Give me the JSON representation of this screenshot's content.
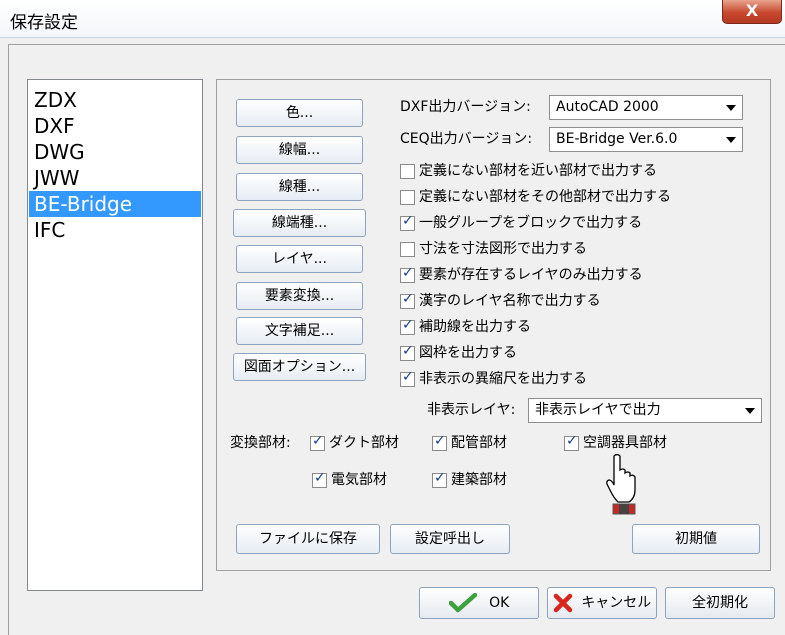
{
  "window": {
    "title": "保存設定",
    "close_label": "X"
  },
  "formats": [
    "ZDX",
    "DXF",
    "DWG",
    "JWW",
    "BE-Bridge",
    "IFC"
  ],
  "selected_format": "BE-Bridge",
  "side_buttons": [
    "色...",
    "線幅...",
    "線種...",
    "線端種...",
    "レイヤ...",
    "要素変換...",
    "文字補足...",
    "図面オプション..."
  ],
  "dxf_version": {
    "label": "DXF出力バージョン:",
    "value": "AutoCAD 2000"
  },
  "ceq_version": {
    "label": "CEQ出力バージョン:",
    "value": "BE-Bridge Ver.6.0"
  },
  "options": [
    {
      "label": "定義にない部材を近い部材で出力する",
      "checked": false
    },
    {
      "label": "定義にない部材をその他部材で出力する",
      "checked": false
    },
    {
      "label": "一般グループをブロックで出力する",
      "checked": true
    },
    {
      "label": "寸法を寸法図形で出力する",
      "checked": false
    },
    {
      "label": "要素が存在するレイヤのみ出力する",
      "checked": true
    },
    {
      "label": "漢字のレイヤ名称で出力する",
      "checked": true
    },
    {
      "label": "補助線を出力する",
      "checked": true
    },
    {
      "label": "図枠を出力する",
      "checked": true
    },
    {
      "label": "非表示の異縮尺を出力する",
      "checked": true
    }
  ],
  "hidden_layer": {
    "label": "非表示レイヤ:",
    "value": "非表示レイヤで出力"
  },
  "conversion": {
    "label": "変換部材:",
    "items": [
      {
        "label": "ダクト部材",
        "checked": true
      },
      {
        "label": "配管部材",
        "checked": true
      },
      {
        "label": "空調器具部材",
        "checked": true
      },
      {
        "label": "電気部材",
        "checked": true
      },
      {
        "label": "建築部材",
        "checked": true
      }
    ]
  },
  "bottom_buttons": {
    "save_file": "ファイルに保存",
    "load_settings": "設定呼出し",
    "reset": "初期値"
  },
  "dialog_buttons": {
    "ok": "OK",
    "cancel": "キャンセル",
    "reset_all": "全初期化"
  },
  "colors": {
    "selection": "#3399ff",
    "ok_icon": "#3aa23a",
    "cancel_icon": "#d9261c",
    "close_button": "#c9472f"
  }
}
